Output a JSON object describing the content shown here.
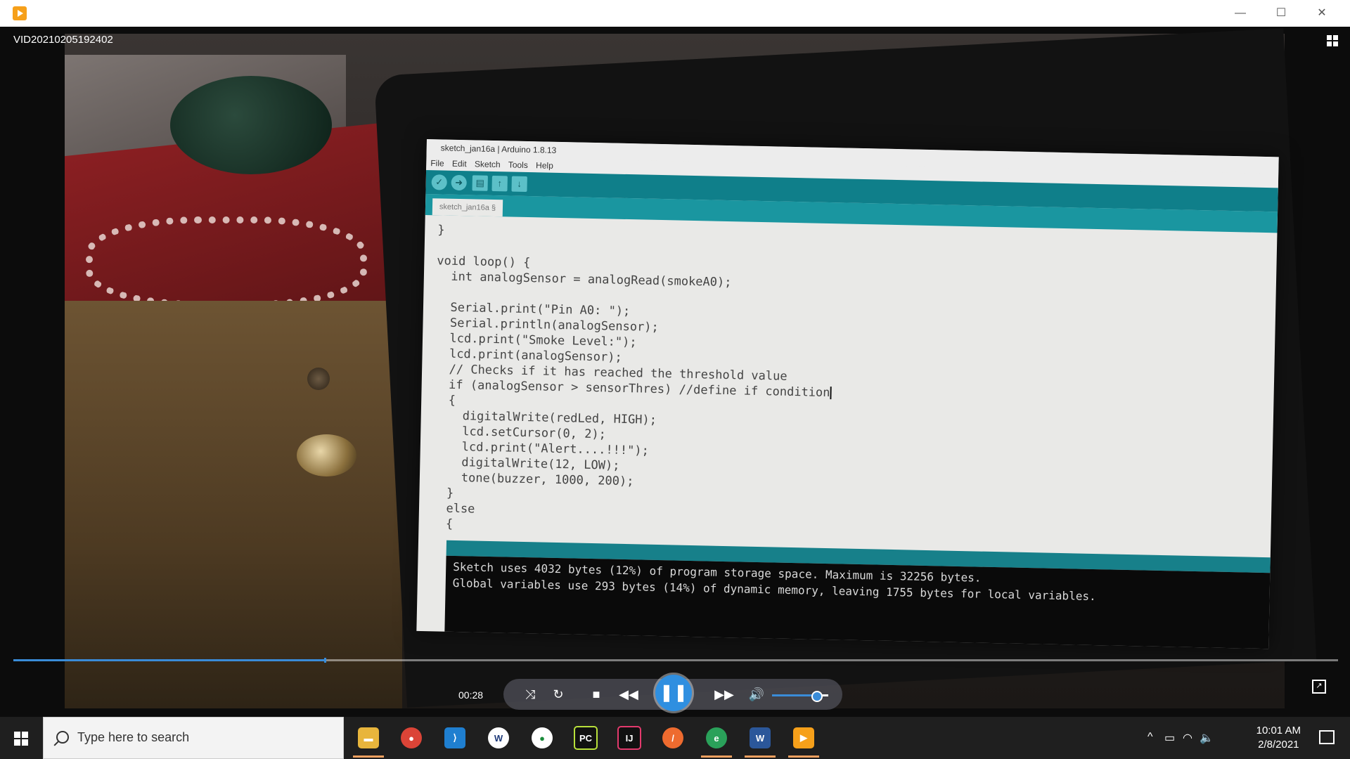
{
  "window": {
    "app_icon": "media-player-icon",
    "controls": [
      "—",
      "☐",
      "✕"
    ]
  },
  "video": {
    "title": "VID20210205192402",
    "ide": {
      "title": "sketch_jan16a | Arduino 1.8.13",
      "menu": [
        "File",
        "Edit",
        "Sketch",
        "Tools",
        "Help"
      ],
      "tab": "sketch_jan16a §",
      "code_lines": [
        "}",
        "",
        "void loop() {",
        "  int analogSensor = analogRead(smokeA0);",
        "",
        "  Serial.print(\"Pin A0: \");",
        "  Serial.println(analogSensor);",
        "  lcd.print(\"Smoke Level:\");",
        "  lcd.print(analogSensor);",
        "  // Checks if it has reached the threshold value",
        "  if (analogSensor > sensorThres) //define if condition",
        "  {",
        "    digitalWrite(redLed, HIGH);",
        "    lcd.setCursor(0, 2);",
        "    lcd.print(\"Alert....!!!\");",
        "    digitalWrite(12, LOW);",
        "    tone(buzzer, 1000, 200);",
        "  }",
        "  else",
        "  {"
      ],
      "console": [
        "Sketch uses 4032 bytes (12%) of program storage space. Maximum is 32256 bytes.",
        "Global variables use 293 bytes (14%) of dynamic memory, leaving 1755 bytes for local variables."
      ]
    }
  },
  "player": {
    "current_time": "00:28",
    "progress_fraction": 0.235,
    "volume_fraction": 0.8,
    "icons": [
      "shuffle-icon",
      "repeat-icon",
      "stop-icon",
      "rewind-icon",
      "pause-icon",
      "fast-forward-icon",
      "volume-icon",
      "expand-icon"
    ]
  },
  "taskbar": {
    "search_placeholder": "Type here to search",
    "apps": [
      "file-explorer",
      "chrome",
      "vscode",
      "word-alt",
      "app-green",
      "pycharm",
      "intellij",
      "app-orange",
      "edge",
      "word",
      "media-player"
    ],
    "time": "10:01 AM",
    "date": "2/8/2021"
  },
  "colors": {
    "accent": "#3a8cd8",
    "arduino_teal": "#0f7f8a"
  }
}
